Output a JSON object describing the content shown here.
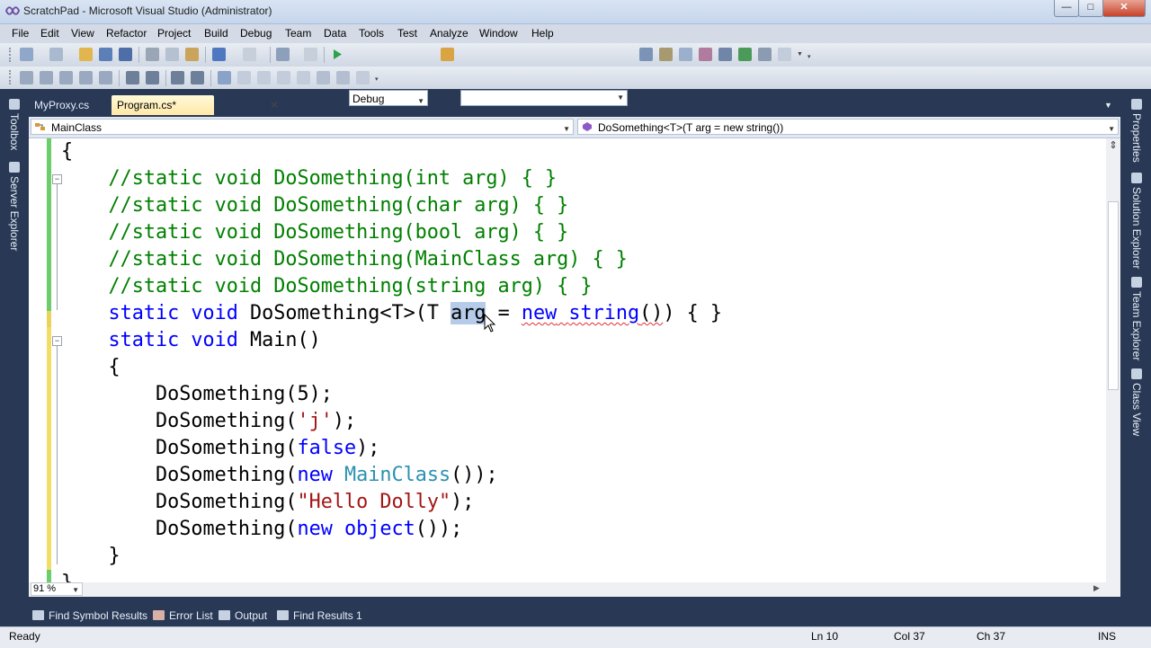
{
  "window": {
    "title": "ScratchPad - Microsoft Visual Studio (Administrator)",
    "controls": {
      "minimize": "—",
      "maximize": "□",
      "close": "✕"
    }
  },
  "menu": [
    "File",
    "Edit",
    "View",
    "Refactor",
    "Project",
    "Build",
    "Debug",
    "Team",
    "Data",
    "Tools",
    "Test",
    "Analyze",
    "Window",
    "Help"
  ],
  "toolbar": {
    "configuration": "Debug",
    "platform": ""
  },
  "left_panels": [
    "Toolbox",
    "Server Explorer"
  ],
  "right_panels": [
    "Properties",
    "Solution Explorer",
    "Team Explorer",
    "Class View"
  ],
  "tabs": [
    {
      "label": "MyProxy.cs",
      "active": false
    },
    {
      "label": "Program.cs*",
      "active": true,
      "close": "✕"
    }
  ],
  "navbar": {
    "type": "MainClass",
    "member": "DoSomething<T>(T arg = new string())"
  },
  "code": {
    "lines": [
      [
        {
          "t": "{",
          "c": "plain"
        }
      ],
      [
        {
          "t": "    //static void DoSomething(int arg) { }",
          "c": "comment"
        }
      ],
      [
        {
          "t": "    //static void DoSomething(char arg) { }",
          "c": "comment"
        }
      ],
      [
        {
          "t": "    //static void DoSomething(bool arg) { }",
          "c": "comment"
        }
      ],
      [
        {
          "t": "    //static void DoSomething(MainClass arg) { }",
          "c": "comment"
        }
      ],
      [
        {
          "t": "    //static void DoSomething(string arg) { }",
          "c": "comment"
        }
      ],
      [
        {
          "t": "    ",
          "c": "plain"
        },
        {
          "t": "static",
          "c": "keyword"
        },
        {
          "t": " ",
          "c": "plain"
        },
        {
          "t": "void",
          "c": "keyword"
        },
        {
          "t": " DoSomething<T>(T ",
          "c": "plain"
        },
        {
          "t": "arg",
          "c": "selected"
        },
        {
          "t": " = ",
          "c": "plain"
        },
        {
          "t": "new",
          "c": "keyword-squiggle"
        },
        {
          "t": " ",
          "c": "squiggle"
        },
        {
          "t": "string",
          "c": "keyword-squiggle"
        },
        {
          "t": "()",
          "c": "squiggle"
        },
        {
          "t": ") { }",
          "c": "plain"
        }
      ],
      [
        {
          "t": "    ",
          "c": "plain"
        },
        {
          "t": "static",
          "c": "keyword"
        },
        {
          "t": " ",
          "c": "plain"
        },
        {
          "t": "void",
          "c": "keyword"
        },
        {
          "t": " Main()",
          "c": "plain"
        }
      ],
      [
        {
          "t": "    {",
          "c": "plain"
        }
      ],
      [
        {
          "t": "        DoSomething(5);",
          "c": "plain"
        }
      ],
      [
        {
          "t": "        DoSomething(",
          "c": "plain"
        },
        {
          "t": "'j'",
          "c": "string"
        },
        {
          "t": ");",
          "c": "plain"
        }
      ],
      [
        {
          "t": "        DoSomething(",
          "c": "plain"
        },
        {
          "t": "false",
          "c": "keyword"
        },
        {
          "t": ");",
          "c": "plain"
        }
      ],
      [
        {
          "t": "        DoSomething(",
          "c": "plain"
        },
        {
          "t": "new",
          "c": "keyword"
        },
        {
          "t": " ",
          "c": "plain"
        },
        {
          "t": "MainClass",
          "c": "type"
        },
        {
          "t": "());",
          "c": "plain"
        }
      ],
      [
        {
          "t": "        DoSomething(",
          "c": "plain"
        },
        {
          "t": "\"Hello Dolly\"",
          "c": "string"
        },
        {
          "t": ");",
          "c": "plain"
        }
      ],
      [
        {
          "t": "        DoSomething(",
          "c": "plain"
        },
        {
          "t": "new",
          "c": "keyword"
        },
        {
          "t": " ",
          "c": "plain"
        },
        {
          "t": "object",
          "c": "keyword"
        },
        {
          "t": "());",
          "c": "plain"
        }
      ],
      [
        {
          "t": "    }",
          "c": "plain"
        }
      ],
      [
        {
          "t": "}",
          "c": "plain"
        }
      ]
    ]
  },
  "zoom": "91 %",
  "tool_tabs": [
    "Find Symbol Results",
    "Error List",
    "Output",
    "Find Results 1"
  ],
  "status": {
    "message": "Ready",
    "line": "Ln 10",
    "col": "Col 37",
    "ch": "Ch 37",
    "mode": "INS"
  },
  "colors": {
    "keyword": "#0000ff",
    "comment": "#008000",
    "type": "#2b91af",
    "string": "#a31515",
    "selection": "#b5cbe9",
    "chrome": "#293955"
  }
}
